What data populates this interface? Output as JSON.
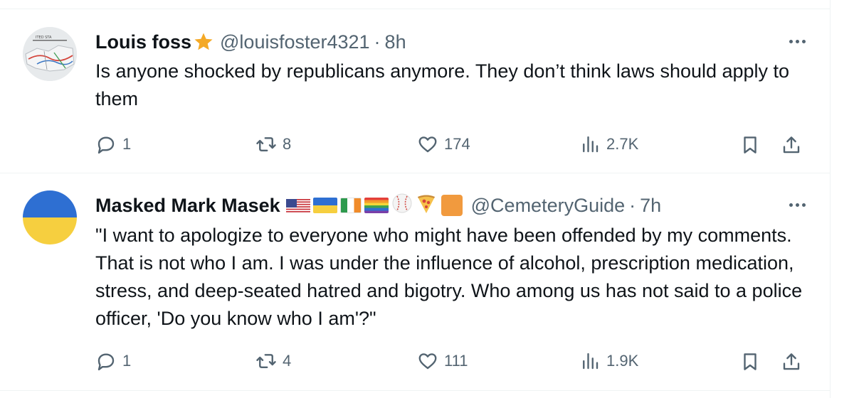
{
  "tweets": [
    {
      "name": "Louis foss",
      "handle": "@louisfoster4321",
      "separator": "·",
      "time": "8h",
      "text": "Is anyone shocked by republicans anymore. They don’t think laws should apply to them",
      "replies": "1",
      "retweets": "8",
      "likes": "174",
      "views": "2.7K",
      "avatar": "map-avatar",
      "name_emoji": "star-icon",
      "avatar_text": "ITED STA"
    },
    {
      "name": "Masked Mark Masek",
      "handle": "@CemeteryGuide",
      "separator": "·",
      "time": "7h",
      "text": "\"I want to apologize to everyone who might have been offended by my comments. That is not who I am. I was under the influence of alcohol, prescription medication, stress, and deep-seated hatred and bigotry. Who among us has not said to a police officer, 'Do you know who I am'?\"",
      "replies": "1",
      "retweets": "4",
      "likes": "111",
      "views": "1.9K",
      "avatar": "ukraine-flag-avatar",
      "name_emoji": [
        "us-flag-icon",
        "ukraine-flag-icon",
        "ireland-flag-icon",
        "rainbow-flag-icon",
        "baseball-icon",
        "pizza-icon",
        "orange-square-icon"
      ]
    }
  ],
  "colors": {
    "text": "#0f1419",
    "secondary": "#536471",
    "border": "#eff3f4",
    "star": "#f4a926"
  }
}
